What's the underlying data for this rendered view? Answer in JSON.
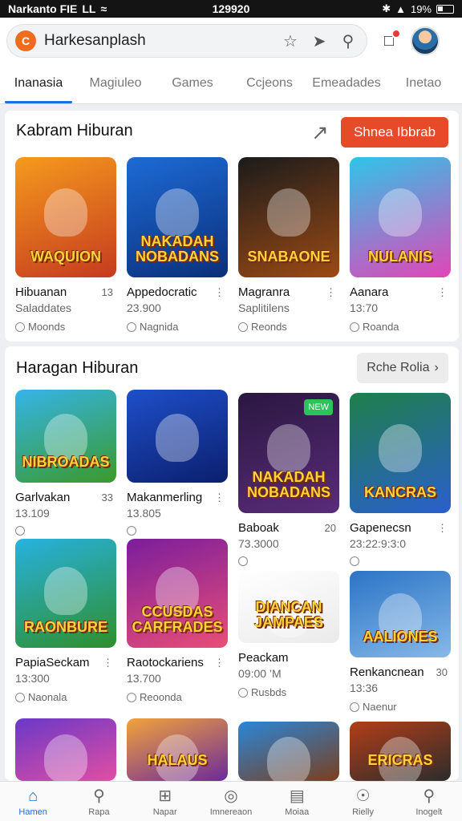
{
  "status": {
    "carrier": "Narkanto FIE",
    "carrier_suffix": "LL",
    "time": "129920",
    "battery": "19%"
  },
  "search": {
    "value": "Harkesanplash",
    "brand_letter": "C"
  },
  "tabs": [
    {
      "label": "Inanasia",
      "active": true
    },
    {
      "label": "Magiuleo"
    },
    {
      "label": "Games"
    },
    {
      "label": "Ccjeons"
    },
    {
      "label": "Emeadades"
    },
    {
      "label": "Inetao"
    }
  ],
  "section1": {
    "title": "Kabram Hiburan",
    "button": "Shnea Ibbrab",
    "items": [
      {
        "name": "Hibuanan",
        "meta": "13",
        "sub": "Saladdates",
        "dev": "Moonds",
        "art": "WAQUION",
        "bg": [
          "#f59a1e",
          "#c53b1f"
        ]
      },
      {
        "name": "Appedocratic",
        "meta": "⋮",
        "sub": "23.900",
        "dev": "Nagnida",
        "art": "NAKADAH NOBADANS",
        "bg": [
          "#1d6bd6",
          "#0b2f7a"
        ]
      },
      {
        "name": "Magranra",
        "meta": "⋮",
        "sub": "Saplitilens",
        "dev": "Reonds",
        "art": "SNABAONE",
        "bg": [
          "#1b1b1b",
          "#9c4a14"
        ]
      },
      {
        "name": "Aanara",
        "meta": "⋮",
        "sub": "13:70",
        "dev": "Roanda",
        "art": "NULANIS",
        "bg": [
          "#2ec5e8",
          "#e245b8"
        ]
      }
    ]
  },
  "section2": {
    "title": "Haragan Hiburan",
    "button": "Rche Rolia",
    "items": [
      {
        "name": "Garlvakan",
        "meta": "33",
        "sub": "13.109",
        "dev": "",
        "art": "NIBROADAS",
        "bg": [
          "#35b4e8",
          "#3a9a2a"
        ]
      },
      {
        "name": "Makanmerling",
        "meta": "⋮",
        "sub": "13.805",
        "dev": "",
        "art": "",
        "bg": [
          "#1e4fc9",
          "#0b1f6e"
        ]
      },
      {
        "name": "Baboak",
        "meta": "20",
        "sub": "73.3000",
        "dev": "",
        "art": "NAKADAH NOBADANS",
        "bg": [
          "#2a1740",
          "#5a2c7a"
        ],
        "badge": "NEW"
      },
      {
        "name": "Gapenecsn",
        "meta": "⋮",
        "sub": "23:22:9:3:0",
        "dev": "",
        "art": "KANCRAS",
        "bg": [
          "#1f7f4a",
          "#2a5fcc"
        ]
      },
      {
        "name": "PapiaSeckam",
        "meta": "⋮",
        "sub": "13:300",
        "dev": "Naonala",
        "art": "RAONBURE",
        "bg": [
          "#27b1e0",
          "#2f8f2b"
        ]
      },
      {
        "name": "Raotockariens",
        "meta": "⋮",
        "sub": "13.700",
        "dev": "Reoonda",
        "art": "CCUSDAS CARFRADES",
        "bg": [
          "#7b1d9c",
          "#e94e77"
        ]
      },
      {
        "name": "Peackam",
        "meta": "",
        "sub": "09:00 ’M",
        "dev": "Rusbds",
        "art": "DIANCAN JAMPAES",
        "bg": [
          "#ffffff",
          "#eaeaea"
        ]
      },
      {
        "name": "Renkancnean",
        "meta": "30",
        "sub": "13:36",
        "dev": "Naenur",
        "art": "AALIONES",
        "bg": [
          "#2b74c6",
          "#86b9e8"
        ]
      },
      {
        "name": "",
        "meta": "",
        "sub": "",
        "dev": "",
        "art": "",
        "bg": [
          "#6a38c8",
          "#e24ea3"
        ]
      },
      {
        "name": "",
        "meta": "",
        "sub": "",
        "dev": "",
        "art": "HALAUS",
        "bg": [
          "#f2a33a",
          "#6b2a9a"
        ]
      },
      {
        "name": "",
        "meta": "",
        "sub": "",
        "dev": "",
        "art": "",
        "bg": [
          "#2a86d8",
          "#7a3f1e"
        ]
      },
      {
        "name": "",
        "meta": "",
        "sub": "",
        "dev": "",
        "art": "ERICRAS",
        "bg": [
          "#b23e18",
          "#2c2c2c"
        ]
      }
    ]
  },
  "bottom_nav": [
    {
      "label": "Hamen",
      "icon": "home-icon",
      "active": true
    },
    {
      "label": "Rapa",
      "icon": "search-icon"
    },
    {
      "label": "Napar",
      "icon": "apps-icon"
    },
    {
      "label": "Imnereaon",
      "icon": "compass-icon"
    },
    {
      "label": "Moiaa",
      "icon": "book-icon"
    },
    {
      "label": "Rielly",
      "icon": "gamepad-icon"
    },
    {
      "label": "Inogelt",
      "icon": "search-icon"
    }
  ],
  "colors": {
    "accent": "#1e6fd9",
    "cta": "#e64a28"
  }
}
